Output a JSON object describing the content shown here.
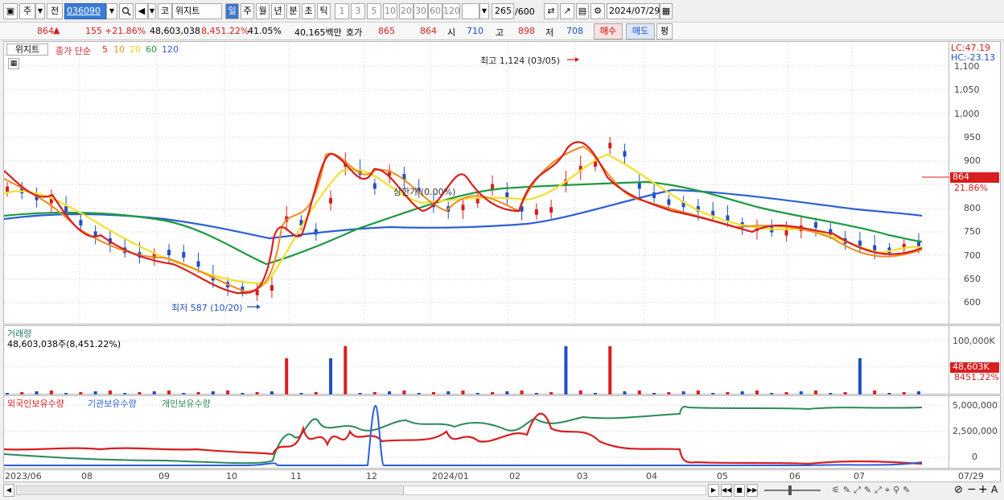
{
  "toolbar": {
    "type_label": "주",
    "prev_label": "전",
    "code_value": "036090",
    "market_label": "코",
    "stock_name": "위지트",
    "periods": [
      "일",
      "주",
      "월",
      "년",
      "분",
      "초",
      "틱"
    ],
    "active_period": "일",
    "intervals": [
      "1",
      "3",
      "5",
      "10",
      "20",
      "30",
      "60",
      "120"
    ],
    "count_value": "265",
    "count_total": "/600",
    "date_value": "2024/07/29"
  },
  "quote": {
    "price": "864",
    "change_arrow": "▲",
    "change": "155",
    "change_pct": "+21.86%",
    "volume": "48,603,038",
    "volume_ratio": "8,451.22%",
    "turnover": "41.05%",
    "amount": "40,165백만",
    "bid_ask_label": "호가",
    "ask": "865",
    "bid": "864",
    "open_label": "시",
    "open": "710",
    "high_label": "고",
    "high": "898",
    "low_label": "저",
    "low": "708",
    "buy_label": "매수",
    "sell_label": "매도",
    "eval_label": "평"
  },
  "colors": {
    "up": "#d81e1e",
    "down": "#1f4fc4",
    "ma5": "#d81e1e",
    "ma10": "#f08a1c",
    "ma20": "#f2e12a",
    "ma60": "#1e9a3e",
    "ma120": "#2d5fd6"
  },
  "price_panel": {
    "tab_label": "위지트",
    "legend_prefix": "종가 단순",
    "ma": [
      {
        "label": "5",
        "color": "#d81e1e"
      },
      {
        "label": "10",
        "color": "#f08a1c"
      },
      {
        "label": "20",
        "color": "#e6d21e"
      },
      {
        "label": "60",
        "color": "#1e9a3e"
      },
      {
        "label": "120",
        "color": "#2d5fd6"
      }
    ],
    "lc_label": "LC:47.19",
    "hc_label": "HC:-23.13",
    "high_annot": "최고 1,124 (03/05)",
    "low_annot": "최저 587 (10/20)",
    "mid_annot": "상한가 (0.00%)",
    "y_ticks": [
      "1,100",
      "1,050",
      "1,000",
      "950",
      "900",
      "850",
      "800",
      "750",
      "700",
      "650",
      "600"
    ],
    "last_price_tag": "864",
    "last_pct_tag": "21.86%"
  },
  "volume_panel": {
    "title": "거래량",
    "value_label": "48,603,038주(8,451.22%)",
    "y_tick": "100,000K",
    "last_tag": "48,603K",
    "last_pct": "8451.22%"
  },
  "holdings_panel": {
    "legend": [
      {
        "label": "외국인보유수량",
        "color": "#d81e1e"
      },
      {
        "label": "기관보유수량",
        "color": "#2d5fd6"
      },
      {
        "label": "개인보유수량",
        "color": "#2a8a5a"
      }
    ],
    "y_ticks": [
      "5,000,000",
      "2,500,000",
      "0"
    ]
  },
  "x_axis": [
    "2023/06",
    "08",
    "09",
    "10",
    "11",
    "12",
    "2024/01",
    "02",
    "03",
    "04",
    "05",
    "06",
    "07"
  ],
  "x_axis_right": "07/29",
  "chart_data": {
    "type": "line",
    "title": "",
    "y_range": [
      560,
      1125
    ],
    "series": [
      {
        "name": "5",
        "values": [
          845,
          830,
          815,
          820,
          790,
          760,
          735,
          720,
          700,
          690,
          700,
          695,
          690,
          670,
          640,
          625,
          615,
          620,
          630,
          780,
          760,
          740,
          820,
          900,
          870,
          840,
          880,
          860,
          830,
          800,
          790,
          805,
          820,
          850,
          820,
          790,
          795,
          800,
          860,
          890,
          900,
          940,
          910,
          840,
          820,
          805,
          800,
          790,
          780,
          770,
          755,
          760,
          745,
          750,
          760,
          755,
          740,
          720,
          715,
          705,
          700,
          720,
          715
        ]
      }
    ]
  }
}
